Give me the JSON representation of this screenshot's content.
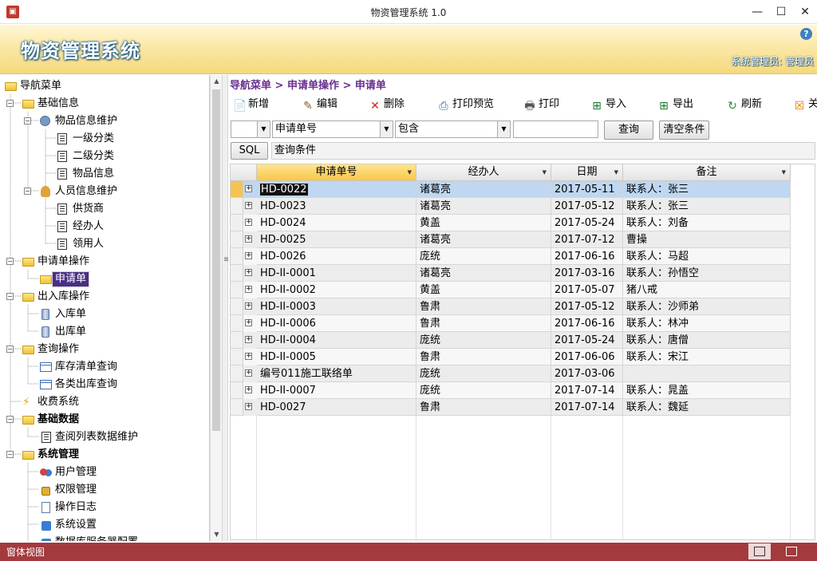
{
  "window": {
    "title": "物资管理系统 1.0",
    "minimize": "—",
    "maximize": "☐",
    "close": "✕"
  },
  "banner": {
    "app_title": "物资管理系统",
    "user_info": "系统管理员: 管理员",
    "help": "?"
  },
  "nav": {
    "items": [
      {
        "label": "导航菜单",
        "icon": "folder-icon"
      },
      {
        "label": "基础信息",
        "icon": "folder-icon"
      },
      {
        "label": "物品信息维护",
        "icon": "gear-icon"
      },
      {
        "label": "一级分类",
        "icon": "document-icon"
      },
      {
        "label": "二级分类",
        "icon": "document-icon"
      },
      {
        "label": "物品信息",
        "icon": "document-icon"
      },
      {
        "label": "人员信息维护",
        "icon": "person-icon"
      },
      {
        "label": "供货商",
        "icon": "document-icon"
      },
      {
        "label": "经办人",
        "icon": "document-icon"
      },
      {
        "label": "领用人",
        "icon": "document-icon"
      },
      {
        "label": "申请单操作",
        "icon": "folder-icon"
      },
      {
        "label": "申请单",
        "icon": "folder-icon"
      },
      {
        "label": "出入库操作",
        "icon": "folder-icon"
      },
      {
        "label": "入库单",
        "icon": "database-icon"
      },
      {
        "label": "出库单",
        "icon": "database-icon"
      },
      {
        "label": "查询操作",
        "icon": "folder-icon"
      },
      {
        "label": "库存清单查询",
        "icon": "table-icon"
      },
      {
        "label": "各类出库查询",
        "icon": "table-icon"
      },
      {
        "label": "收费系统",
        "icon": "bolt-icon"
      },
      {
        "label": "基础数据",
        "icon": "folder-icon"
      },
      {
        "label": "查阅列表数据维护",
        "icon": "list-icon"
      },
      {
        "label": "系统管理",
        "icon": "folder-icon"
      },
      {
        "label": "用户管理",
        "icon": "users-icon"
      },
      {
        "label": "权限管理",
        "icon": "lock-icon"
      },
      {
        "label": "操作日志",
        "icon": "page-icon"
      },
      {
        "label": "系统设置",
        "icon": "settings-icon"
      },
      {
        "label": "数据库服务器配置",
        "icon": "settings-icon"
      }
    ]
  },
  "breadcrumb": "导航菜单 > 申请单操作 > 申请单",
  "toolbar": {
    "new": "新增",
    "edit": "编辑",
    "delete": "删除",
    "print_preview": "打印预览",
    "print": "打印",
    "import": "导入",
    "export": "导出",
    "refresh": "刷新",
    "close": "关"
  },
  "filter": {
    "field_select": "",
    "field": "申请单号",
    "operator": "包含",
    "value": "",
    "query_button": "查询",
    "clear_button": "清空条件",
    "sql_button": "SQL",
    "condition_label": "查询条件"
  },
  "grid": {
    "columns": [
      "申请单号",
      "经办人",
      "日期",
      "备注"
    ],
    "rows": [
      {
        "id": "HD-0022",
        "handler": "诸葛亮",
        "date": "2017-05-11",
        "note": "联系人：张三"
      },
      {
        "id": "HD-0023",
        "handler": "诸葛亮",
        "date": "2017-05-12",
        "note": "联系人：张三"
      },
      {
        "id": "HD-0024",
        "handler": "黄盖",
        "date": "2017-05-24",
        "note": "联系人：刘备"
      },
      {
        "id": "HD-0025",
        "handler": "诸葛亮",
        "date": "2017-07-12",
        "note": "曹操"
      },
      {
        "id": "HD-0026",
        "handler": "庞统",
        "date": "2017-06-16",
        "note": "联系人：马超"
      },
      {
        "id": "HD-II-0001",
        "handler": "诸葛亮",
        "date": "2017-03-16",
        "note": "联系人：孙悟空"
      },
      {
        "id": "HD-II-0002",
        "handler": "黄盖",
        "date": "2017-05-07",
        "note": "猪八戒"
      },
      {
        "id": "HD-II-0003",
        "handler": "鲁肃",
        "date": "2017-05-12",
        "note": "联系人：沙师弟"
      },
      {
        "id": "HD-II-0006",
        "handler": "鲁肃",
        "date": "2017-06-16",
        "note": "联系人：林冲"
      },
      {
        "id": "HD-II-0004",
        "handler": "庞统",
        "date": "2017-05-24",
        "note": "联系人：唐僧"
      },
      {
        "id": "HD-II-0005",
        "handler": "鲁肃",
        "date": "2017-06-06",
        "note": "联系人：宋江"
      },
      {
        "id": "编号011施工联络单",
        "handler": "庞统",
        "date": "2017-03-06",
        "note": ""
      },
      {
        "id": "HD-II-0007",
        "handler": "庞统",
        "date": "2017-07-14",
        "note": "联系人：晁盖"
      },
      {
        "id": "HD-0027",
        "handler": "鲁肃",
        "date": "2017-07-14",
        "note": "联系人：魏延"
      }
    ]
  },
  "statusbar": {
    "label": "窗体视图"
  }
}
